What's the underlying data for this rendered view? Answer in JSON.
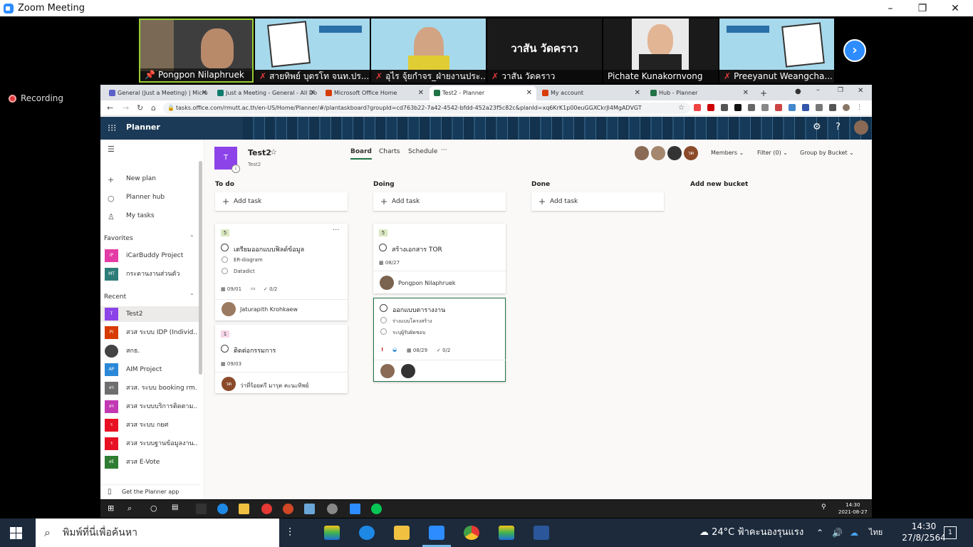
{
  "zoom": {
    "title": "Zoom Meeting",
    "recording": "Recording",
    "window_controls": [
      "–",
      "❐",
      "✕"
    ],
    "participants": [
      {
        "name": "Pongpon Nilaphruek",
        "muted": false,
        "pinned": true
      },
      {
        "name": "สายทิพย์  บุตรโท จนท.ปร...",
        "muted": true
      },
      {
        "name": "อุไร จุ้ยกำจร_ฝ่ายงานประ...",
        "muted": true
      },
      {
        "name": "วาสัน วัดคราว",
        "muted": true,
        "video_text": "วาสัน วัดคราว"
      },
      {
        "name": "Pichate Kunakornvong",
        "muted": false
      },
      {
        "name": "Preeyanut Weangcha...",
        "muted": true
      }
    ],
    "next_icon": "›"
  },
  "browser": {
    "tabs": [
      {
        "label": "General (Just a Meeting) | Micro",
        "color": "#5b5fc7"
      },
      {
        "label": "Just a Meeting - General - All Do",
        "color": "#0f7b6c"
      },
      {
        "label": "Microsoft Office Home",
        "color": "#d83b01"
      },
      {
        "label": "Test2 - Planner",
        "color": "#217346",
        "active": true
      },
      {
        "label": "My account",
        "color": "#d83b01"
      },
      {
        "label": "Hub - Planner",
        "color": "#217346"
      }
    ],
    "new_tab": "+",
    "url": "tasks.office.com/rmutt.ac.th/en-US/Home/Planner/#/plantaskboard?groupId=cd763b22-7a42-4542-bfdd-452a23f5c82c&planId=xq6KrK1p00euGGXCkrJl4MgADVGT"
  },
  "planner": {
    "app_title": "Planner",
    "nav": {
      "new_plan": "New plan",
      "hub": "Planner hub",
      "my_tasks": "My tasks",
      "favorites_label": "Favorites",
      "favorites": [
        {
          "badge": "iP",
          "label": "iCarBuddy Project",
          "color": "#e43ba6"
        },
        {
          "badge": "MT",
          "label": "กระดานงานส่วนตัว",
          "color": "#2e7d78"
        }
      ],
      "recent_label": "Recent",
      "recent": [
        {
          "badge": "T",
          "label": "Test2",
          "color": "#8c43e8"
        },
        {
          "badge": "PI",
          "label": "สวส ระบบ IDP (Individ...",
          "color": "#d83b01"
        },
        {
          "badge": "",
          "label": "สกธ.",
          "color": "#444444"
        },
        {
          "badge": "AP",
          "label": "AIM Project",
          "color": "#2b88d8"
        },
        {
          "badge": "สร",
          "label": "สวส. ระบบ booking rm...",
          "color": "#6e6e6e"
        },
        {
          "badge": "สร",
          "label": "สวส ระบบบริการติดตาม...",
          "color": "#c239b3"
        },
        {
          "badge": "ร",
          "label": "สวส ระบบ กยศ",
          "color": "#e81123"
        },
        {
          "badge": "ร",
          "label": "สวส ระบบฐานข้อมูลงาน...",
          "color": "#e81123"
        },
        {
          "badge": "สE",
          "label": "สวส E-Vote",
          "color": "#2e7d32"
        }
      ],
      "get_app": "Get the Planner app"
    },
    "plan": {
      "badge": "T",
      "name": "Test2",
      "group": "Test2",
      "views": [
        "Board",
        "Charts",
        "Schedule"
      ],
      "more": "···",
      "member_badge": "วด",
      "members": "Members",
      "filter": "Filter (0)",
      "group_by": "Group by Bucket"
    },
    "buckets": [
      {
        "name": "To do",
        "add": "Add task"
      },
      {
        "name": "Doing",
        "add": "Add task"
      },
      {
        "name": "Done",
        "add": "Add task"
      },
      {
        "name": "Add new bucket"
      }
    ],
    "cards": {
      "todo1": {
        "progress": "5",
        "title": "เตรียมออกแบบฟิลด์ข้อมูล",
        "checklist": [
          "ER-diagram",
          "Datadict"
        ],
        "date": "09/01",
        "checks": "0/2",
        "assignee": "Jaturapith Krohkaew"
      },
      "todo2": {
        "progress": "1",
        "title": "ติดต่อกรรมการ",
        "date": "09/03",
        "assignee_badge": "วด",
        "assignee": "ว่าที่ร้อยตรี มารุต คะนะทิพย์"
      },
      "doing1": {
        "progress": "5",
        "title": "สร้างเอกสาร TOR",
        "date": "08/27",
        "assignee": "Pongpon Nilaphruek"
      },
      "doing2": {
        "title": "ออกแบบตารางงาน",
        "checklist": [
          "ร่างแบบโครงสร้าง",
          "ระบุผู้รับผิดชอบ"
        ],
        "urgent": "!",
        "date": "08/29",
        "checks": "0/2"
      }
    }
  },
  "inner_taskbar": {
    "time": "14:30",
    "date": "2021-08-27"
  },
  "taskbar": {
    "search_placeholder": "พิมพ์ที่นี่เพื่อค้นหา",
    "weather": "24°C  ฟ้าคะนองรุนแรง",
    "lang": "ไทย",
    "time": "14:30",
    "date": "27/8/2564",
    "notifications": "1"
  },
  "icons": {
    "search": "⌕",
    "plus": "+",
    "hub": "○",
    "person": "♙",
    "star": "☆",
    "calendar": "▦",
    "check": "✓",
    "gear": "⚙",
    "help": "?",
    "waffle": "⋮⋮⋮"
  }
}
